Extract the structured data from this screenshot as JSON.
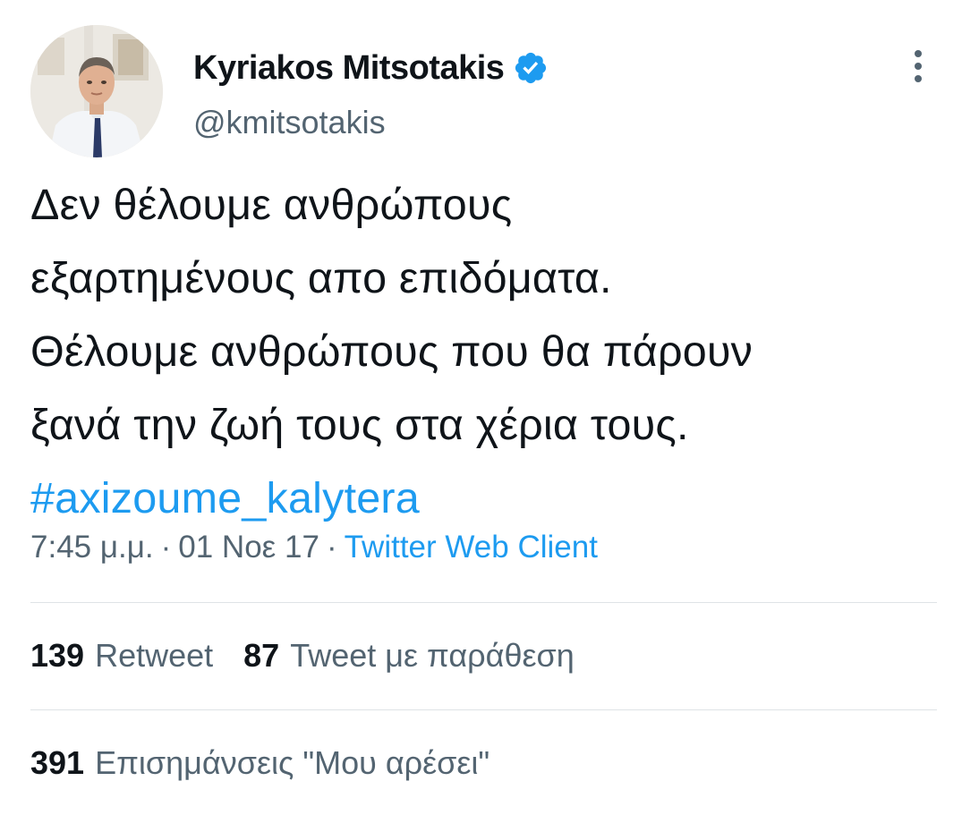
{
  "author": {
    "display_name": "Kyriakos Mitsotakis",
    "handle": "@kmitsotakis",
    "verified_icon": "verified-badge-icon",
    "badge_color": "#1d9bf0"
  },
  "more_icon": "more-options-icon",
  "tweet": {
    "lines": [
      "Δεν θέλουμε ανθρώπους",
      "εξαρτημένους απο επιδόματα.",
      "Θέλουμε ανθρώπους που θα πάρουν",
      "ξανά την ζωή τους στα χέρια τους."
    ],
    "hashtag": "#axizoume_kalytera"
  },
  "meta": {
    "time": "7:45 μ.μ.",
    "separator": "·",
    "date": "01 Νοε 17",
    "client": "Twitter Web Client"
  },
  "stats": {
    "retweets_count": "139",
    "retweets_label": "Retweet",
    "quotes_count": "87",
    "quotes_label": "Tweet με παράθεση",
    "likes_count": "391",
    "likes_label": "Επισημάνσεις \"Μου αρέσει\""
  },
  "colors": {
    "text": "#0f1419",
    "secondary": "#536471",
    "link": "#1d9bf0",
    "divider": "#dfe3e6"
  }
}
